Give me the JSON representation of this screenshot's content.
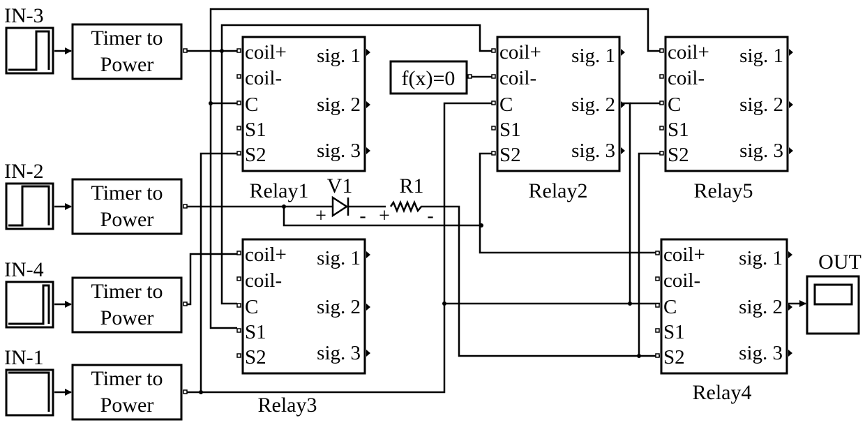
{
  "inputs": [
    {
      "label": "IN-3",
      "block": "Timer to Power"
    },
    {
      "label": "IN-2",
      "block": "Timer to Power"
    },
    {
      "label": "IN-4",
      "block": "Timer to Power"
    },
    {
      "label": "IN-1",
      "block": "Timer to Power"
    }
  ],
  "timer_line1": "Timer to",
  "timer_line2": "Power",
  "relay_ports": {
    "in": [
      "coil+",
      "coil-",
      "C",
      "S1",
      "S2"
    ],
    "out": [
      "sig. 1",
      "sig. 2",
      "sig. 3"
    ]
  },
  "relays": [
    {
      "name": "Relay1"
    },
    {
      "name": "Relay2"
    },
    {
      "name": "Relay3"
    },
    {
      "name": "Relay4"
    },
    {
      "name": "Relay5"
    }
  ],
  "constant_block": "f(x)=0",
  "diode": {
    "name": "V1",
    "plus": "+",
    "minus": "-"
  },
  "resistor": {
    "name": "R1",
    "plus": "+",
    "minus": "-"
  },
  "output": {
    "label": "OUT"
  }
}
